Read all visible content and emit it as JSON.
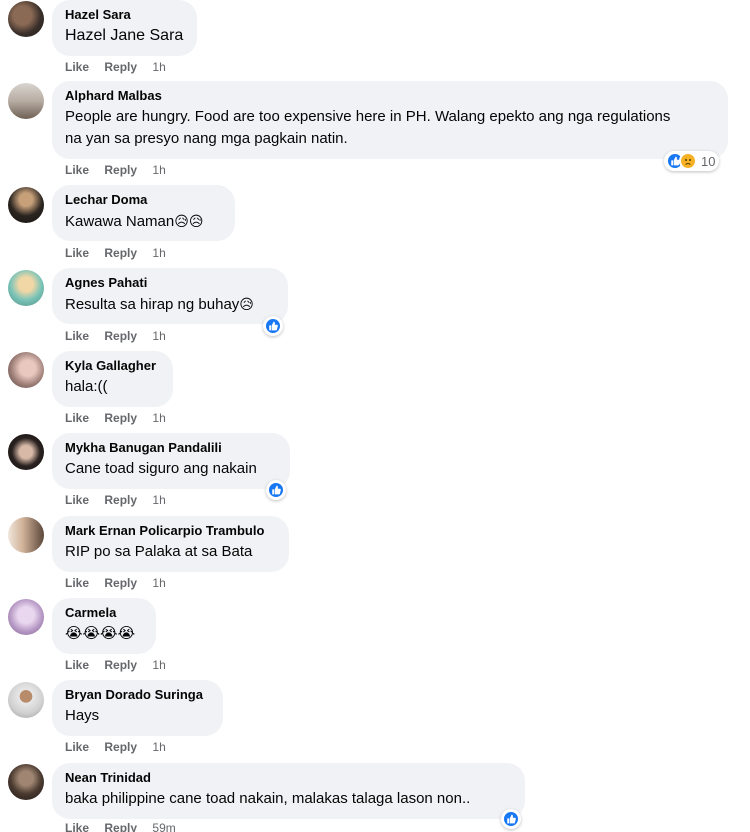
{
  "comments": [
    {
      "author": "Hazel Sara",
      "text": "Hazel Jane Sara",
      "like": "Like",
      "reply": "Reply",
      "time": "1h"
    },
    {
      "author": "Alphard Malbas",
      "text": "People are hungry. Food are too expensive here in PH. Walang epekto ang nga regulations na yan sa presyo nang mga pagkain natin.",
      "like": "Like",
      "reply": "Reply",
      "time": "1h",
      "reaction_count": "10"
    },
    {
      "author": "Lechar Doma",
      "text": "Kawawa Naman",
      "text_emoji": "😥😥",
      "like": "Like",
      "reply": "Reply",
      "time": "1h"
    },
    {
      "author": "Agnes Pahati",
      "text": "Resulta sa hirap ng buhay",
      "text_emoji": "😥",
      "like": "Like",
      "reply": "Reply",
      "time": "1h"
    },
    {
      "author": "Kyla Gallagher",
      "text": "hala:((",
      "like": "Like",
      "reply": "Reply",
      "time": "1h"
    },
    {
      "author": "Mykha Banugan Pandalili",
      "text": "Cane toad siguro ang nakain",
      "like": "Like",
      "reply": "Reply",
      "time": "1h"
    },
    {
      "author": "Mark Ernan Policarpio Trambulo",
      "text": "RIP po sa Palaka at sa Bata",
      "like": "Like",
      "reply": "Reply",
      "time": "1h"
    },
    {
      "author": "Carmela",
      "text": "😭😭😭😭",
      "like": "Like",
      "reply": "Reply",
      "time": "1h"
    },
    {
      "author": "Bryan Dorado Suringa",
      "text": "Hays",
      "like": "Like",
      "reply": "Reply",
      "time": "1h"
    },
    {
      "author": "Nean Trinidad",
      "text": "baka philippine cane toad nakain, malakas talaga lason non..",
      "like": "Like",
      "reply": "Reply",
      "time": "59m"
    }
  ],
  "colors": {
    "bubble": "#f0f2f5",
    "like_blue": "#1877f2",
    "muted": "#65676b"
  },
  "icons": {
    "like": "like-thumb-icon",
    "sad": "sad-face-icon"
  }
}
